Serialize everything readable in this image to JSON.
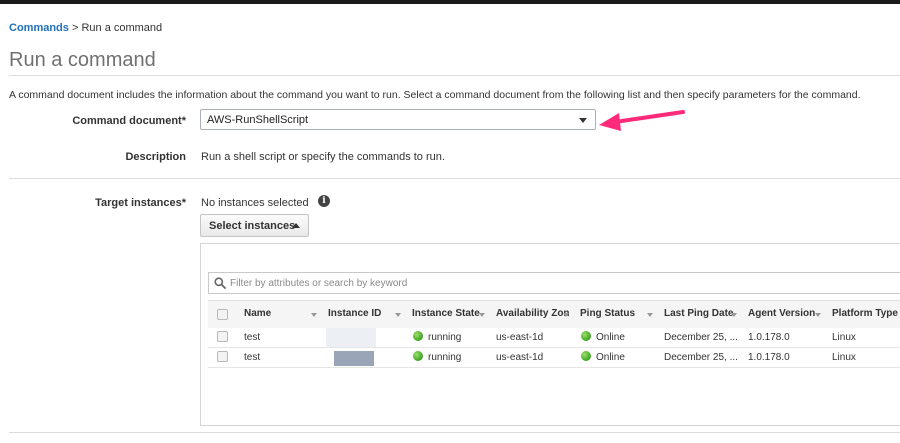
{
  "breadcrumb": {
    "parent": "Commands",
    "separator": " > ",
    "current": "Run a command"
  },
  "page": {
    "title": "Run a command",
    "intro": "A command document includes the information about the command you want to run. Select a command document from the following list and then specify parameters for the command."
  },
  "form": {
    "command_document_label": "Command document*",
    "command_document_value": "AWS-RunShellScript",
    "description_label": "Description",
    "description_value": "Run a shell script or specify the commands to run.",
    "target_label": "Target instances*",
    "target_value": "No instances selected",
    "info_icon": "i",
    "select_button": "Select instances"
  },
  "filter": {
    "placeholder": "Filter by attributes or search by keyword"
  },
  "table": {
    "columns": [
      "Name",
      "Instance ID",
      "Instance State",
      "Availability Zon",
      "Ping Status",
      "Last Ping Date",
      "Agent Version",
      "Platform Type"
    ],
    "rows": [
      {
        "name": "test",
        "instance_id": "",
        "state": "running",
        "zone": "us-east-1d",
        "ping": "Online",
        "last_ping": "December 25, ...",
        "agent": "1.0.178.0",
        "platform": "Linux"
      },
      {
        "name": "test",
        "instance_id": "",
        "state": "running",
        "zone": "us-east-1d",
        "ping": "Online",
        "last_ping": "December 25, ...",
        "agent": "1.0.178.0",
        "platform": "Linux"
      }
    ]
  },
  "colors": {
    "link": "#1e70b8",
    "status_green": "#3da320",
    "arrow": "#ff2a7a"
  },
  "icons": {
    "dropdown": "caret-down-icon",
    "select_button": "caret-up-icon",
    "filter": "search-icon",
    "info": "info-icon",
    "annotation": "annotation-arrow-icon"
  }
}
